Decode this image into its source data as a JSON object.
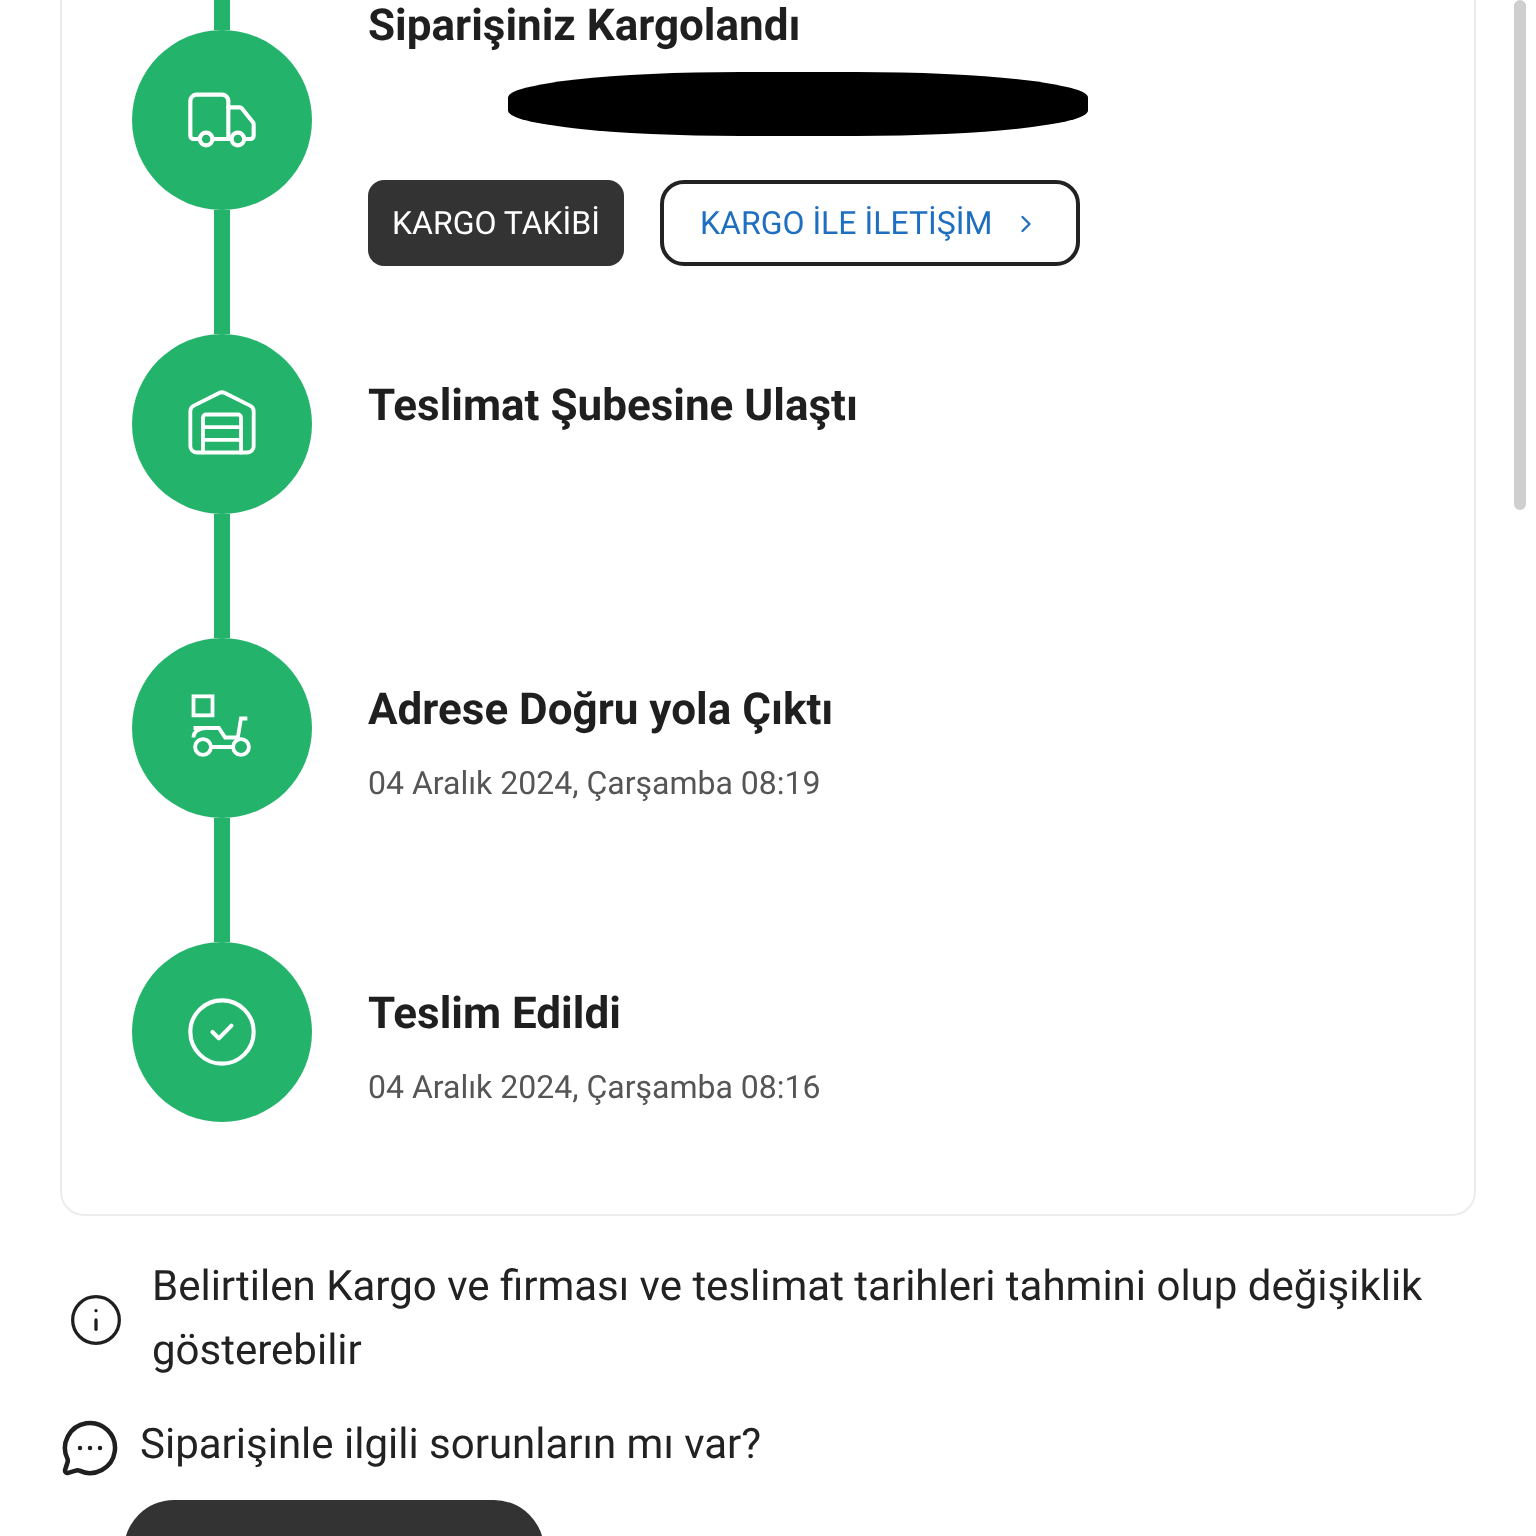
{
  "steps": [
    {
      "title": "Siparişiniz Kargolandı",
      "buttons": [
        {
          "label": "KARGO TAKİBİ",
          "kind": "filled"
        },
        {
          "label": "KARGO İLE İLETİŞİM",
          "kind": "outline"
        }
      ]
    },
    {
      "title": "Teslimat Şubesine Ulaştı"
    },
    {
      "title": "Adrese Doğru yola Çıktı",
      "date": "04 Aralık 2024, Çarşamba 08:19"
    },
    {
      "title": "Teslim Edildi",
      "date": "04 Aralık 2024, Çarşamba 08:16"
    }
  ],
  "notice": "Belirtilen Kargo ve firması ve teslimat tarihleri tahmini olup değişiklik gösterebilir",
  "help": "Siparişinle ilgili sorunların mı var?"
}
